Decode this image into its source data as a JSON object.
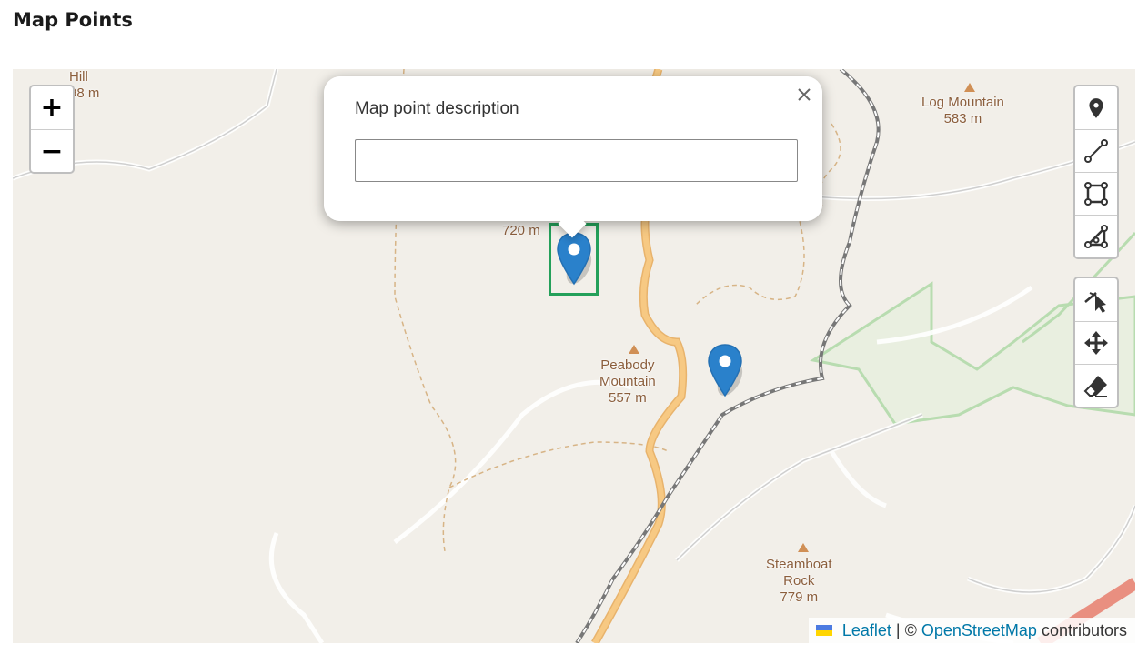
{
  "page": {
    "title": "Map Points"
  },
  "map": {
    "labels": [
      {
        "id": "hill",
        "text": "Hill\n98 m"
      },
      {
        "id": "unnamed",
        "text": "720 m"
      },
      {
        "id": "log-mountain",
        "text": "Log Mountain\n583 m"
      },
      {
        "id": "peabody",
        "text": "Peabody\nMountain\n557 m"
      },
      {
        "id": "steamboat",
        "text": "Steamboat\nRock\n779 m"
      }
    ],
    "zoom": {
      "in_label": "+",
      "out_label": "−"
    },
    "draw_tools": [
      {
        "name": "marker-tool",
        "icon": "map-pin-icon"
      },
      {
        "name": "polyline-tool",
        "icon": "polyline-icon"
      },
      {
        "name": "rectangle-tool",
        "icon": "rectangle-icon"
      },
      {
        "name": "polygon-tool",
        "icon": "polygon-icon"
      }
    ],
    "edit_tools": [
      {
        "name": "cut-tool",
        "icon": "cut-icon"
      },
      {
        "name": "drag-tool",
        "icon": "move-icon"
      },
      {
        "name": "erase-tool",
        "icon": "eraser-icon"
      }
    ],
    "markers": [
      {
        "id": "marker-1",
        "selected": true
      },
      {
        "id": "marker-2",
        "selected": false
      }
    ],
    "popup": {
      "label": "Map point description",
      "input_value": "",
      "input_placeholder": ""
    },
    "attribution": {
      "leaflet_link": "Leaflet",
      "separator": "| ©",
      "osm_link": "OpenStreetMap",
      "suffix": "contributors"
    },
    "colors": {
      "marker_blue": "#2a81cb",
      "selection_border": "#24a05a",
      "road": "#f7c983",
      "railway": "#777777",
      "park": "#b8dcb0",
      "terrain": "#f2efe9"
    }
  }
}
